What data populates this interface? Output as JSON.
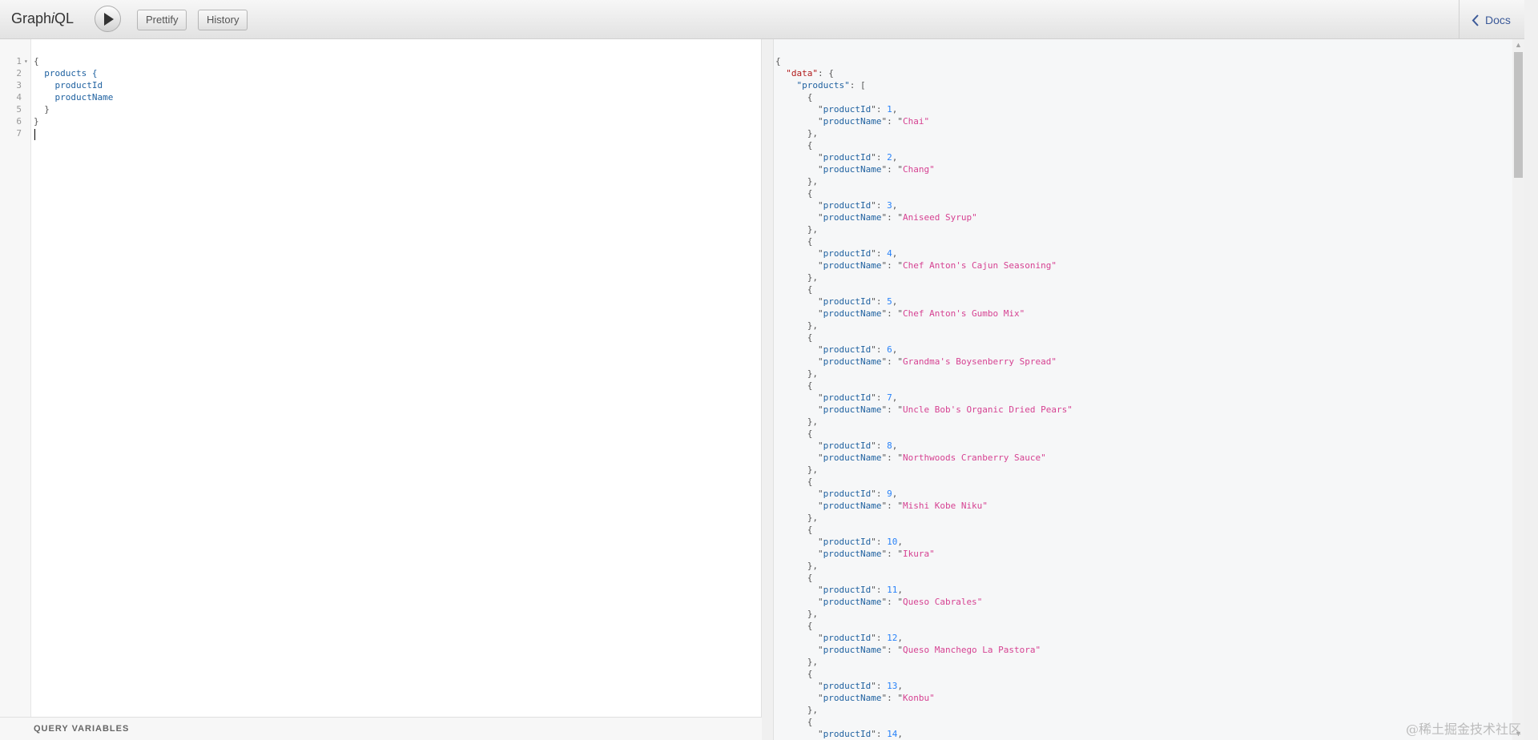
{
  "toolbar": {
    "title_prefix": "Graph",
    "title_italic": "i",
    "title_suffix": "QL",
    "execute_icon": "play-icon",
    "prettify_label": "Prettify",
    "history_label": "History",
    "docs_label": "Docs",
    "docs_icon": "chevron-left-icon"
  },
  "query_editor": {
    "line_numbers": [
      "1",
      "2",
      "3",
      "4",
      "5",
      "6",
      "7"
    ],
    "lines": [
      "{",
      "  products {",
      "    productId",
      "    productName",
      "  }",
      "}",
      ""
    ],
    "query_variables_label": "QUERY VARIABLES"
  },
  "result": {
    "root_open": "{",
    "data_key": "\"data\"",
    "products_key": "\"products\"",
    "products": [
      {
        "productId": 1,
        "productName": "Chai"
      },
      {
        "productId": 2,
        "productName": "Chang"
      },
      {
        "productId": 3,
        "productName": "Aniseed Syrup"
      },
      {
        "productId": 4,
        "productName": "Chef Anton's Cajun Seasoning"
      },
      {
        "productId": 5,
        "productName": "Chef Anton's Gumbo Mix"
      },
      {
        "productId": 6,
        "productName": "Grandma's Boysenberry Spread"
      },
      {
        "productId": 7,
        "productName": "Uncle Bob's Organic Dried Pears"
      },
      {
        "productId": 8,
        "productName": "Northwoods Cranberry Sauce"
      },
      {
        "productId": 9,
        "productName": "Mishi Kobe Niku"
      },
      {
        "productId": 10,
        "productName": "Ikura"
      },
      {
        "productId": 11,
        "productName": "Queso Cabrales"
      },
      {
        "productId": 12,
        "productName": "Queso Manchego La Pastora"
      },
      {
        "productId": 13,
        "productName": "Konbu"
      },
      {
        "productId": 14,
        "productName": null
      }
    ]
  },
  "watermark": "@稀土掘金技术社区",
  "colors": {
    "string": "#d64292",
    "number": "#2882f9",
    "key_data": "#b11a1a",
    "property": "#1f61a0",
    "link": "#3b5998"
  }
}
